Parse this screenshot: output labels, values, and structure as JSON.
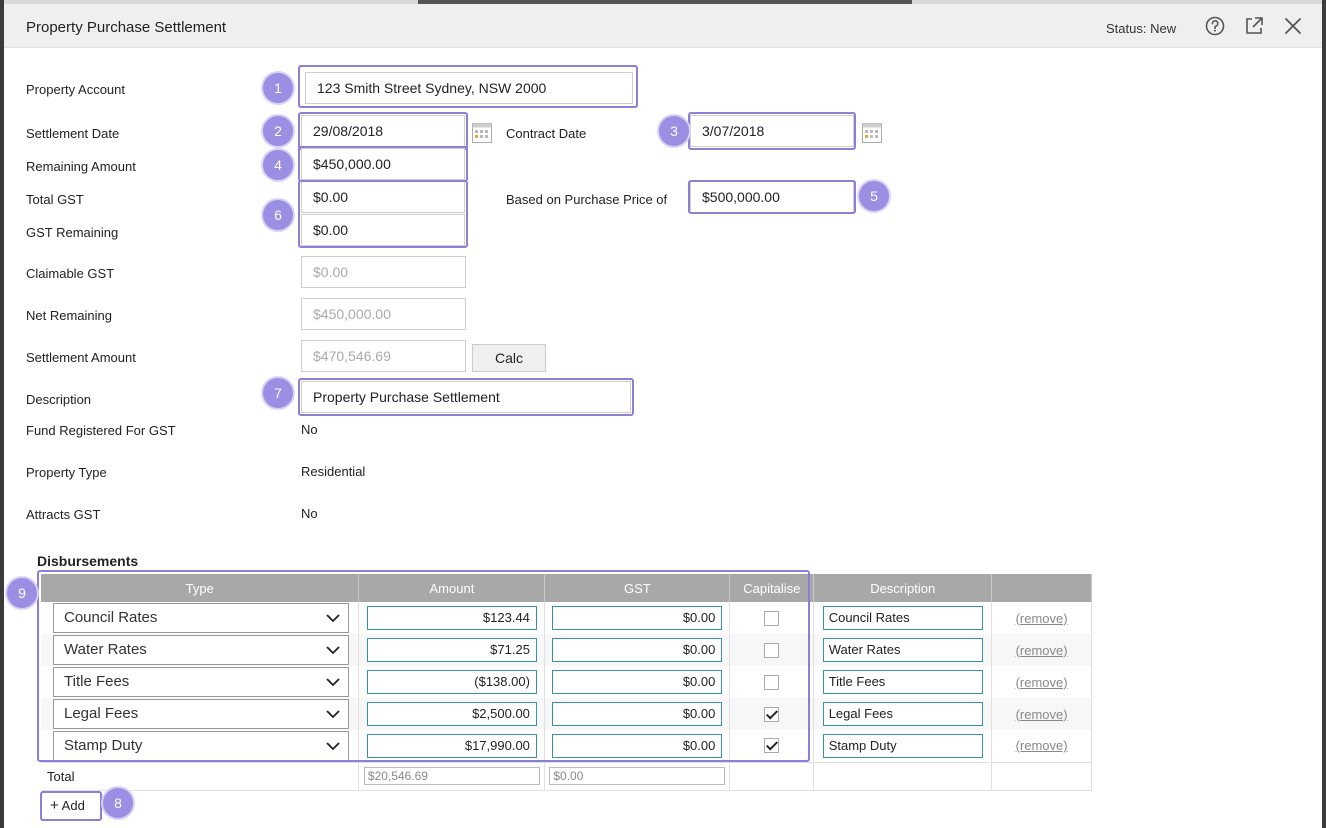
{
  "header": {
    "title": "Property Purchase Settlement",
    "status": "Status: New"
  },
  "icons": {
    "help": "help-circle-icon",
    "popout": "external-link-icon",
    "close": "close-icon",
    "calendar": "calendar-icon",
    "dropdown": "chevron-down-icon"
  },
  "form": {
    "property_account": {
      "label": "Property Account",
      "value": "123 Smith Street Sydney, NSW 2000"
    },
    "settlement_date": {
      "label": "Settlement Date",
      "value": "29/08/2018"
    },
    "contract_date": {
      "label": "Contract Date",
      "value": "3/07/2018"
    },
    "remaining_amount": {
      "label": "Remaining Amount",
      "value": "$450,000.00"
    },
    "total_gst": {
      "label": "Total GST",
      "value": "$0.00"
    },
    "purchase_price": {
      "label": "Based on Purchase Price of",
      "value": "$500,000.00"
    },
    "gst_remaining": {
      "label": "GST Remaining",
      "value": "$0.00"
    },
    "claimable_gst": {
      "label": "Claimable GST",
      "value": "$0.00"
    },
    "net_remaining": {
      "label": "Net Remaining",
      "value": "$450,000.00"
    },
    "settlement_amount": {
      "label": "Settlement Amount",
      "value": "$470,546.69"
    },
    "calc_button": "Calc",
    "description": {
      "label": "Description",
      "value": "Property Purchase Settlement"
    },
    "fund_registered": {
      "label": "Fund Registered For GST",
      "value": "No"
    },
    "property_type": {
      "label": "Property Type",
      "value": "Residential"
    },
    "attracts_gst": {
      "label": "Attracts GST",
      "value": "No"
    }
  },
  "disbursements": {
    "title": "Disbursements",
    "columns": [
      "Type",
      "Amount",
      "GST",
      "Capitalise",
      "Description",
      ""
    ],
    "rows": [
      {
        "type": "Council Rates",
        "amount": "$123.44",
        "gst": "$0.00",
        "capitalise": false,
        "description": "Council Rates",
        "remove": "(remove)"
      },
      {
        "type": "Water Rates",
        "amount": "$71.25",
        "gst": "$0.00",
        "capitalise": false,
        "description": "Water Rates",
        "remove": "(remove)"
      },
      {
        "type": "Title Fees",
        "amount": "($138.00)",
        "gst": "$0.00",
        "capitalise": false,
        "description": "Title Fees",
        "remove": "(remove)"
      },
      {
        "type": "Legal Fees",
        "amount": "$2,500.00",
        "gst": "$0.00",
        "capitalise": true,
        "description": "Legal Fees",
        "remove": "(remove)"
      },
      {
        "type": "Stamp Duty",
        "amount": "$17,990.00",
        "gst": "$0.00",
        "capitalise": true,
        "description": "Stamp Duty",
        "remove": "(remove)"
      }
    ],
    "total": {
      "label": "Total",
      "amount": "$20,546.69",
      "gst": "$0.00"
    },
    "add_button": "Add"
  },
  "badges": [
    "1",
    "2",
    "3",
    "4",
    "5",
    "6",
    "7",
    "8",
    "9"
  ],
  "colors": {
    "highlight": "#8c7fd6",
    "badge": "#9b8fe3",
    "grid_header": "#a8a8a8",
    "field_border": "#3a8fa8"
  }
}
